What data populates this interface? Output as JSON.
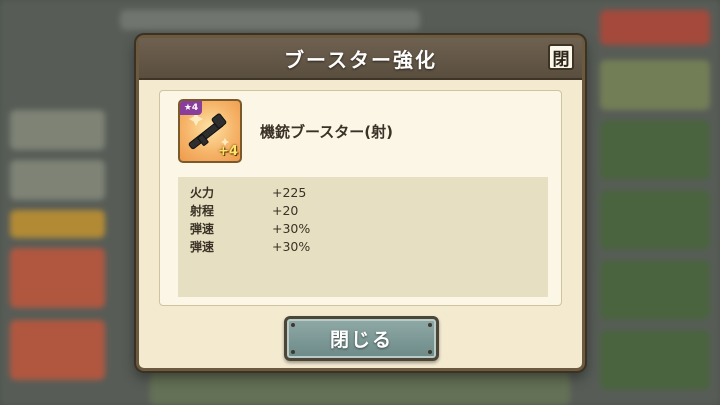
{
  "dialog": {
    "title": "ブースター強化",
    "close_icon_label": "閉",
    "item": {
      "name": "機銃ブースター(射)",
      "rarity_badge": "★4",
      "enhance_badge": "+4",
      "icon": "machine-gun-icon"
    },
    "stats": [
      {
        "label": "火力",
        "value": "+225"
      },
      {
        "label": "射程",
        "value": "+20"
      },
      {
        "label": "弾速",
        "value": "+30%"
      },
      {
        "label": "弾速",
        "value": "+30%"
      }
    ],
    "close_button_label": "閉じる"
  },
  "colors": {
    "title_bar": "#5e5244",
    "panel_bg": "#f3ead0",
    "stats_bg": "#e7dfc1",
    "close_button": "#7e9896",
    "rarity_badge": "#8a3e9c",
    "enhance_badge": "#ffe36a"
  }
}
